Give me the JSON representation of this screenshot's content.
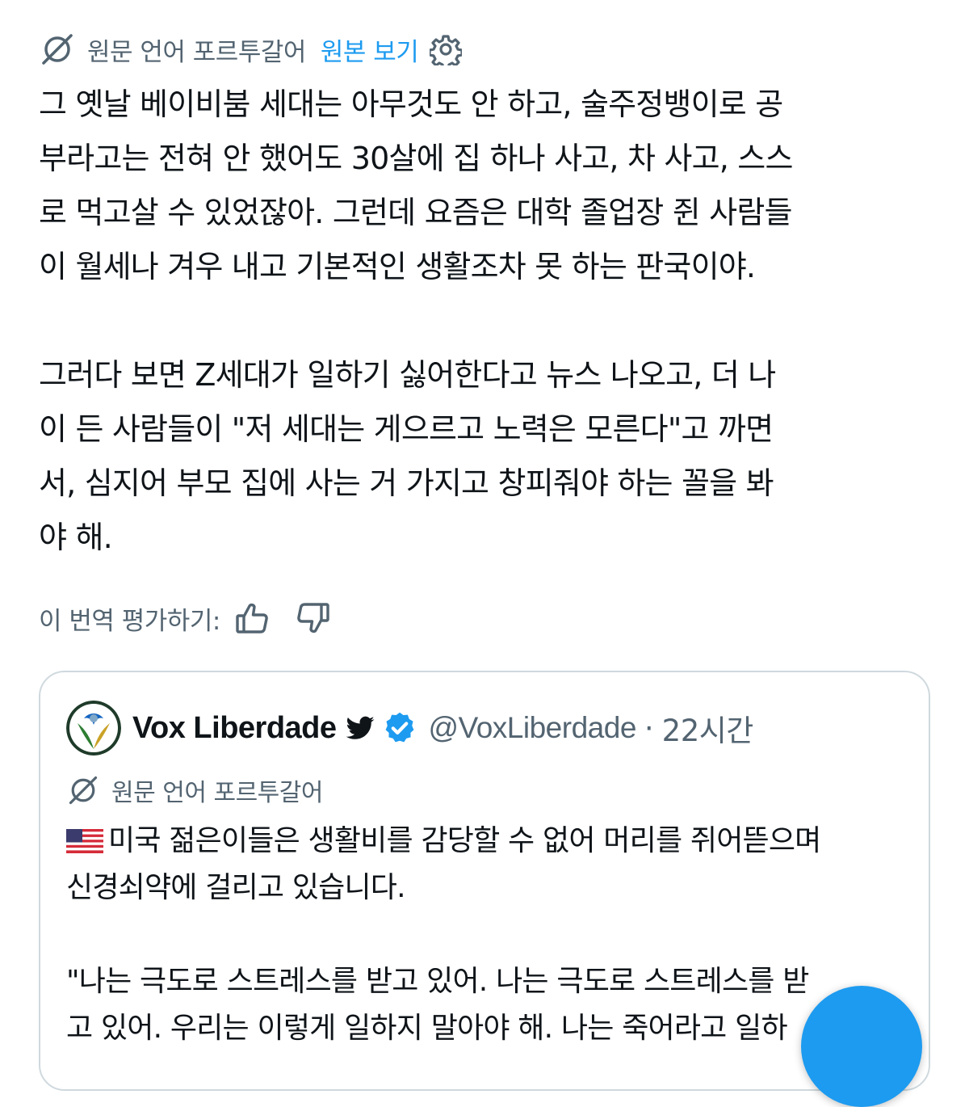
{
  "translation_bar": {
    "label": "원문 언어 포르투갈어",
    "view_original": "원본 보기"
  },
  "tweet": {
    "text": "그 옛날 베이비붐 세대는 아무것도 안 하고, 술주정뱅이로 공\n부라고는 전혀 안 했어도 30살에 집 하나 사고, 차 사고, 스스\n로 먹고살 수 있었잖아. 그런데 요즘은 대학 졸업장 쥔 사람들\n이 월세나 겨우 내고 기본적인 생활조차 못 하는 판국이야.\n\n그러다 보면 Z세대가 일하기 싫어한다고 뉴스 나오고, 더 나\n이 든 사람들이 \"저 세대는 게으르고 노력은 모른다\"고 까면\n서, 심지어 부모 집에 사는 거 가지고 창피줘야 하는 꼴을 봐\n야 해."
  },
  "rating": {
    "label": "이 번역 평가하기:"
  },
  "quote": {
    "name": "Vox Liberdade",
    "handle": "@VoxLiberdade",
    "separator": "·",
    "time": "22시간",
    "translation_label": "원문 언어 포르투갈어",
    "text": "미국 젊은이들은 생활비를 감당할 수 없어 머리를 쥐어뜯으며\n신경쇠약에 걸리고 있습니다.",
    "text2": "\"나는 극도로 스트레스를 받고 있어. 나는 극도로 스트레스를 받\n고 있어. 우리는 이렇게 일하지 말아야 해. 나는 죽어라고 일하"
  },
  "icons": {
    "translate": "translate-icon",
    "settings": "gear-icon",
    "thumbs_up": "thumbs-up-icon",
    "thumbs_down": "thumbs-down-icon",
    "bird": "twitter-bird-icon",
    "verified": "verified-badge-icon",
    "flag": "us-flag-icon",
    "compose": "compose-fab"
  },
  "colors": {
    "accent": "#1d9bf0",
    "secondary_text": "#536471",
    "primary_text": "#0f1419",
    "border": "#cfd9de"
  }
}
